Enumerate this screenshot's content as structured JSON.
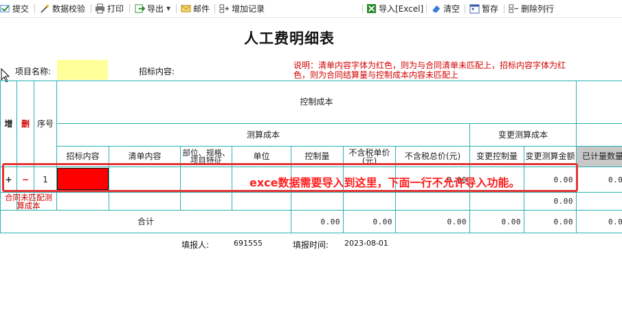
{
  "toolbar": {
    "submit": "提交",
    "validate": "数据校验",
    "print": "打印",
    "export": "导出",
    "mail": "邮件",
    "add_record": "增加记录",
    "import_excel": "导入[Excel]",
    "clear": "清空",
    "save_draft": "暂存",
    "delete_rows": "删除列行"
  },
  "page": {
    "title": "人工费明细表",
    "project_name_label": "项目名称:",
    "tender_content_label": "招标内容:",
    "note": "说明：清单内容字体为红色，则为与合同清单未匹配上，招标内容字体为红色，则为合同结算量与控制成本内容未匹配上"
  },
  "table": {
    "col_add": "增",
    "col_delete": "删",
    "col_seq": "序号",
    "group_control_cost": "控制成本",
    "group_calc_cost": "测算成本",
    "group_change_calc_cost": "变更测算成本",
    "headers": {
      "tender_content": "招标内容",
      "list_content": "清单内容",
      "part_spec": "部位、规格、项目特征",
      "unit": "单位",
      "control_qty": "控制量",
      "unit_price_ex_tax": "不含税单价(元)",
      "total_price_ex_tax": "不含税总价(元)",
      "change_control_qty": "变更控制量",
      "change_calc_amount": "变更测算金额",
      "measured_qty": "已计量数量"
    },
    "row1": {
      "add_btn": "+",
      "del_btn": "−",
      "seq": "1",
      "total_price": "0.00",
      "change_calc_amount": "0.00",
      "measured_qty": "0.0"
    },
    "unmatched_row": {
      "label": "合同未匹配测算成本",
      "change_calc_amount": "0.00"
    },
    "total_row": {
      "label": "合计",
      "control_qty": "0.00",
      "unit_price": "0.00",
      "total_price": "0.00",
      "change_control_qty": "0.00",
      "change_calc_amount": "0.00",
      "measured_qty": "0.0"
    }
  },
  "annotation": {
    "text": "exce数据需要导入到这里，下面一行不允许导入功能。"
  },
  "footer": {
    "filler_label": "填报人:",
    "filler_value": "691555",
    "fill_time_label": "填报时间:",
    "fill_time_value": "2023-08-01"
  },
  "colors": {
    "grid": "#2bb0b0",
    "highlight_input": "#ffff99",
    "annotation_red": "#e53333"
  }
}
